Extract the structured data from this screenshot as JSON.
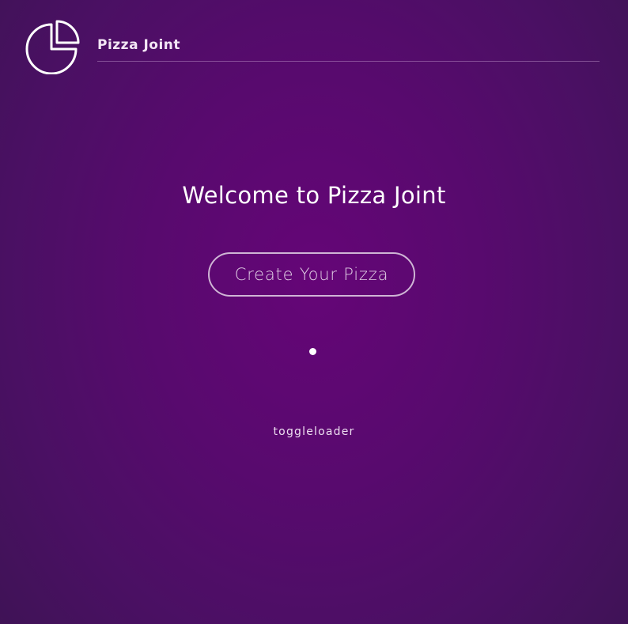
{
  "header": {
    "brand": "Pizza Joint",
    "logo_icon": "pie-chart-icon"
  },
  "main": {
    "welcome": "Welcome to Pizza Joint",
    "cta_label": "Create Your Pizza",
    "loader_icon": "loading-dot-icon",
    "toggle_link": "toggleloader"
  },
  "colors": {
    "background_center": "#650577",
    "background_edge": "#3a1450",
    "text": "#ffffff"
  }
}
